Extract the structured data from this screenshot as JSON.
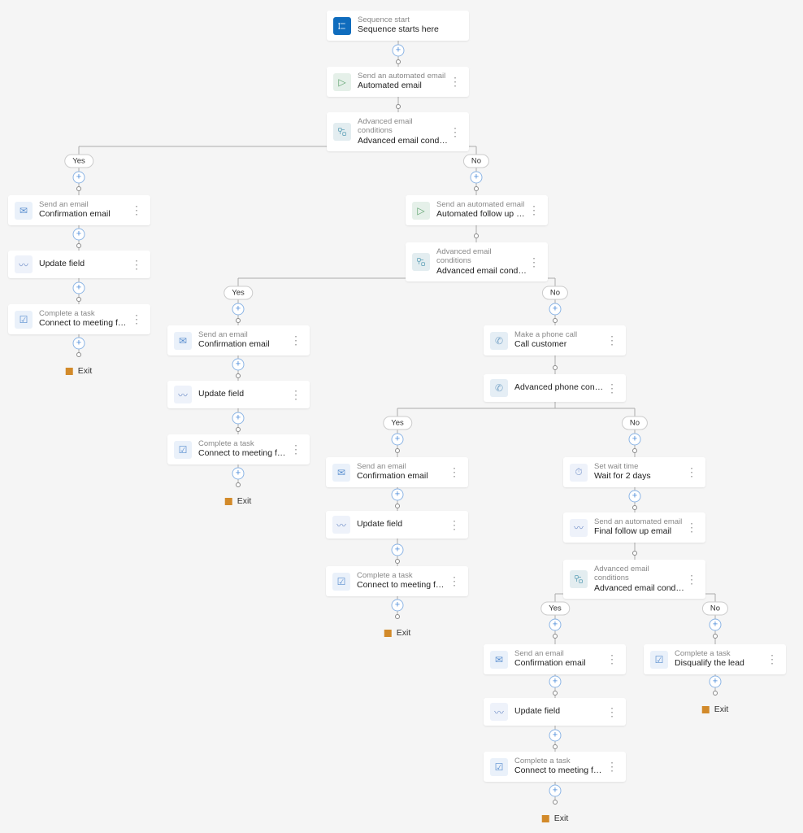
{
  "labels": {
    "yes": "Yes",
    "no": "No",
    "exit": "Exit"
  },
  "nodes": {
    "start": {
      "type": "Sequence start",
      "title": "Sequence starts here"
    },
    "auto1": {
      "type": "Send an automated email",
      "title": "Automated email"
    },
    "cond1": {
      "type": "Advanced email conditions",
      "title": "Advanced email conditions"
    },
    "conf1": {
      "type": "Send an email",
      "title": "Confirmation email"
    },
    "update1": {
      "type": "",
      "title": "Update field"
    },
    "task1": {
      "type": "Complete a task",
      "title": "Connect to meeting for product demo r..."
    },
    "auto2": {
      "type": "Send an automated email",
      "title": "Automated follow up email"
    },
    "cond2": {
      "type": "Advanced email conditions",
      "title": "Advanced email conditions"
    },
    "conf2": {
      "type": "Send an email",
      "title": "Confirmation email"
    },
    "update2": {
      "type": "",
      "title": "Update field"
    },
    "task2": {
      "type": "Complete a task",
      "title": "Connect to meeting for product demo r..."
    },
    "phone": {
      "type": "Make a phone call",
      "title": "Call customer"
    },
    "phonecond": {
      "type": "",
      "title": "Advanced phone condition"
    },
    "conf3": {
      "type": "Send an email",
      "title": "Confirmation email"
    },
    "update3": {
      "type": "",
      "title": "Update field"
    },
    "task3": {
      "type": "Complete a task",
      "title": "Connect to meeting for product demo r..."
    },
    "wait": {
      "type": "Set wait time",
      "title": "Wait for 2 days"
    },
    "finalauto": {
      "type": "Send an automated email",
      "title": "Final follow up email"
    },
    "cond3": {
      "type": "Advanced email conditions",
      "title": "Advanced email conditions"
    },
    "conf4": {
      "type": "Send an email",
      "title": "Confirmation email"
    },
    "update4": {
      "type": "",
      "title": "Update field"
    },
    "task4": {
      "type": "Complete a task",
      "title": "Connect to meeting for product demo r..."
    },
    "disq": {
      "type": "Complete a task",
      "title": "Disqualify the lead"
    }
  }
}
